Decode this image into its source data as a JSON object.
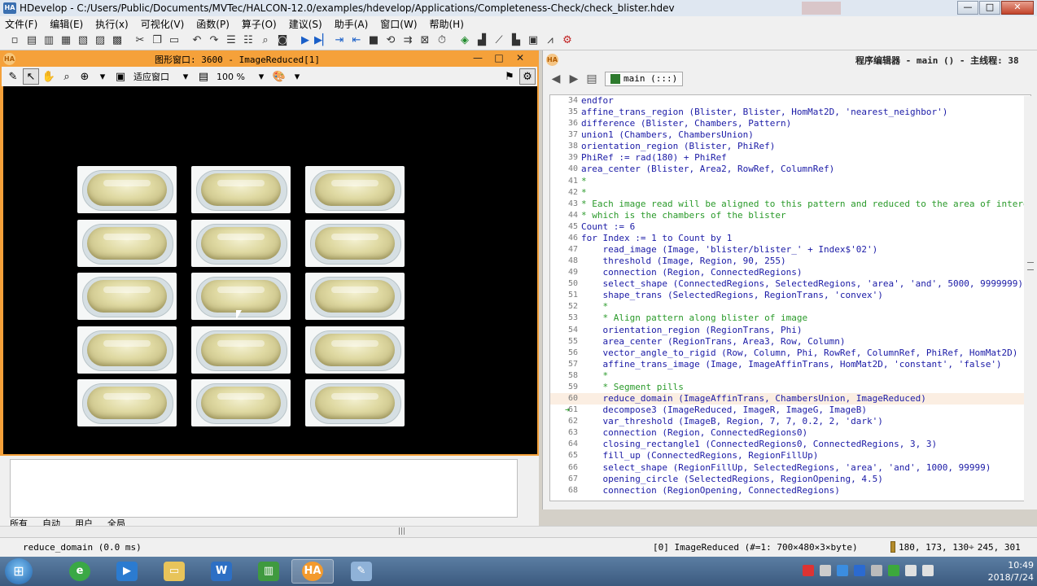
{
  "window": {
    "title": "HDevelop - C:/Users/Public/Documents/MVTec/HALCON-12.0/examples/hdevelop/Applications/Completeness-Check/check_blister.hdev",
    "app_icon": "HA",
    "buttons": {
      "minimize": "—",
      "maximize": "□",
      "close": "✕"
    }
  },
  "menu": {
    "items": [
      "文件(F)",
      "编辑(E)",
      "执行(x)",
      "可视化(V)",
      "函数(P)",
      "算子(O)",
      "建议(S)",
      "助手(A)",
      "窗口(W)",
      "帮助(H)"
    ]
  },
  "graphics_window": {
    "icon": "HA",
    "title": "图形窗口: 3600 - ImageReduced[1]",
    "fit_label": "适应窗口",
    "zoom_label": "100 %",
    "grid_rows": 5,
    "grid_cols": 3
  },
  "lower_panel": {
    "tabs": [
      "所有",
      "自动",
      "用户",
      "全局"
    ]
  },
  "editor": {
    "icon": "HA",
    "title": "程序编辑器 - main () - 主线程: 38",
    "procedure": "main (:::)",
    "lines": [
      {
        "n": "34",
        "text": "endfor",
        "comment": false
      },
      {
        "n": "35",
        "text": "affine_trans_region (Blister, Blister, HomMat2D, 'nearest_neighbor')",
        "comment": false
      },
      {
        "n": "36",
        "text": "difference (Blister, Chambers, Pattern)",
        "comment": false
      },
      {
        "n": "37",
        "text": "union1 (Chambers, ChambersUnion)",
        "comment": false
      },
      {
        "n": "38",
        "text": "orientation_region (Blister, PhiRef)",
        "comment": false
      },
      {
        "n": "39",
        "text": "PhiRef := rad(180) + PhiRef",
        "comment": false
      },
      {
        "n": "40",
        "text": "area_center (Blister, Area2, RowRef, ColumnRef)",
        "comment": false
      },
      {
        "n": "41",
        "text": "*",
        "comment": true
      },
      {
        "n": "42",
        "text": "*",
        "comment": true
      },
      {
        "n": "43",
        "text": "* Each image read will be aligned to this pattern and reduced to the area of intere",
        "comment": true
      },
      {
        "n": "44",
        "text": "* which is the chambers of the blister",
        "comment": true
      },
      {
        "n": "45",
        "text": "Count := 6",
        "comment": false
      },
      {
        "n": "46",
        "text": "for Index := 1 to Count by 1",
        "comment": false
      },
      {
        "n": "47",
        "text": "    read_image (Image, 'blister/blister_' + Index$'02')",
        "comment": false
      },
      {
        "n": "48",
        "text": "    threshold (Image, Region, 90, 255)",
        "comment": false
      },
      {
        "n": "49",
        "text": "    connection (Region, ConnectedRegions)",
        "comment": false
      },
      {
        "n": "50",
        "text": "    select_shape (ConnectedRegions, SelectedRegions, 'area', 'and', 5000, 9999999)",
        "comment": false
      },
      {
        "n": "51",
        "text": "    shape_trans (SelectedRegions, RegionTrans, 'convex')",
        "comment": false
      },
      {
        "n": "52",
        "text": "    *",
        "comment": true
      },
      {
        "n": "53",
        "text": "    * Align pattern along blister of image",
        "comment": true
      },
      {
        "n": "54",
        "text": "    orientation_region (RegionTrans, Phi)",
        "comment": false
      },
      {
        "n": "55",
        "text": "    area_center (RegionTrans, Area3, Row, Column)",
        "comment": false
      },
      {
        "n": "56",
        "text": "    vector_angle_to_rigid (Row, Column, Phi, RowRef, ColumnRef, PhiRef, HomMat2D)",
        "comment": false
      },
      {
        "n": "57",
        "text": "    affine_trans_image (Image, ImageAffinTrans, HomMat2D, 'constant', 'false')",
        "comment": false
      },
      {
        "n": "58",
        "text": "    *",
        "comment": true
      },
      {
        "n": "59",
        "text": "    * Segment pills",
        "comment": true
      },
      {
        "n": "60",
        "text": "    reduce_domain (ImageAffinTrans, ChambersUnion, ImageReduced)",
        "comment": false
      },
      {
        "n": "61",
        "text": "    decompose3 (ImageReduced, ImageR, ImageG, ImageB)",
        "comment": false
      },
      {
        "n": "62",
        "text": "    var_threshold (ImageB, Region, 7, 7, 0.2, 2, 'dark')",
        "comment": false
      },
      {
        "n": "63",
        "text": "    connection (Region, ConnectedRegions0)",
        "comment": false
      },
      {
        "n": "64",
        "text": "    closing_rectangle1 (ConnectedRegions0, ConnectedRegions, 3, 3)",
        "comment": false
      },
      {
        "n": "65",
        "text": "    fill_up (ConnectedRegions, RegionFillUp)",
        "comment": false
      },
      {
        "n": "66",
        "text": "    select_shape (RegionFillUp, SelectedRegions, 'area', 'and', 1000, 99999)",
        "comment": false
      },
      {
        "n": "67",
        "text": "    opening_circle (SelectedRegions, RegionOpening, 4.5)",
        "comment": false
      },
      {
        "n": "68",
        "text": "    connection (RegionOpening, ConnectedRegions)",
        "comment": false
      }
    ],
    "current_line": "61",
    "highlight_line": "60"
  },
  "status": {
    "message": "reduce_domain (0.0 ms)",
    "image_info": "[0] ImageReduced (#=1: 700×480×3×byte)",
    "gray_values": "180, 173, 130",
    "coordinates": "245, 301"
  },
  "taskbar": {
    "start": "⊞",
    "time": "10:49",
    "date": "2018/7/24",
    "apps": [
      "ie-icon",
      "media-icon",
      "explorer-icon",
      "wps-icon",
      "mvtec-icon",
      "halcon-icon",
      "paint-icon"
    ]
  },
  "colors": {
    "graphics_title": "#f5a13a",
    "code_keyword": "#1a1aa6",
    "code_comment": "#2a9a2a",
    "current_line_bg": "#fbeee2"
  }
}
